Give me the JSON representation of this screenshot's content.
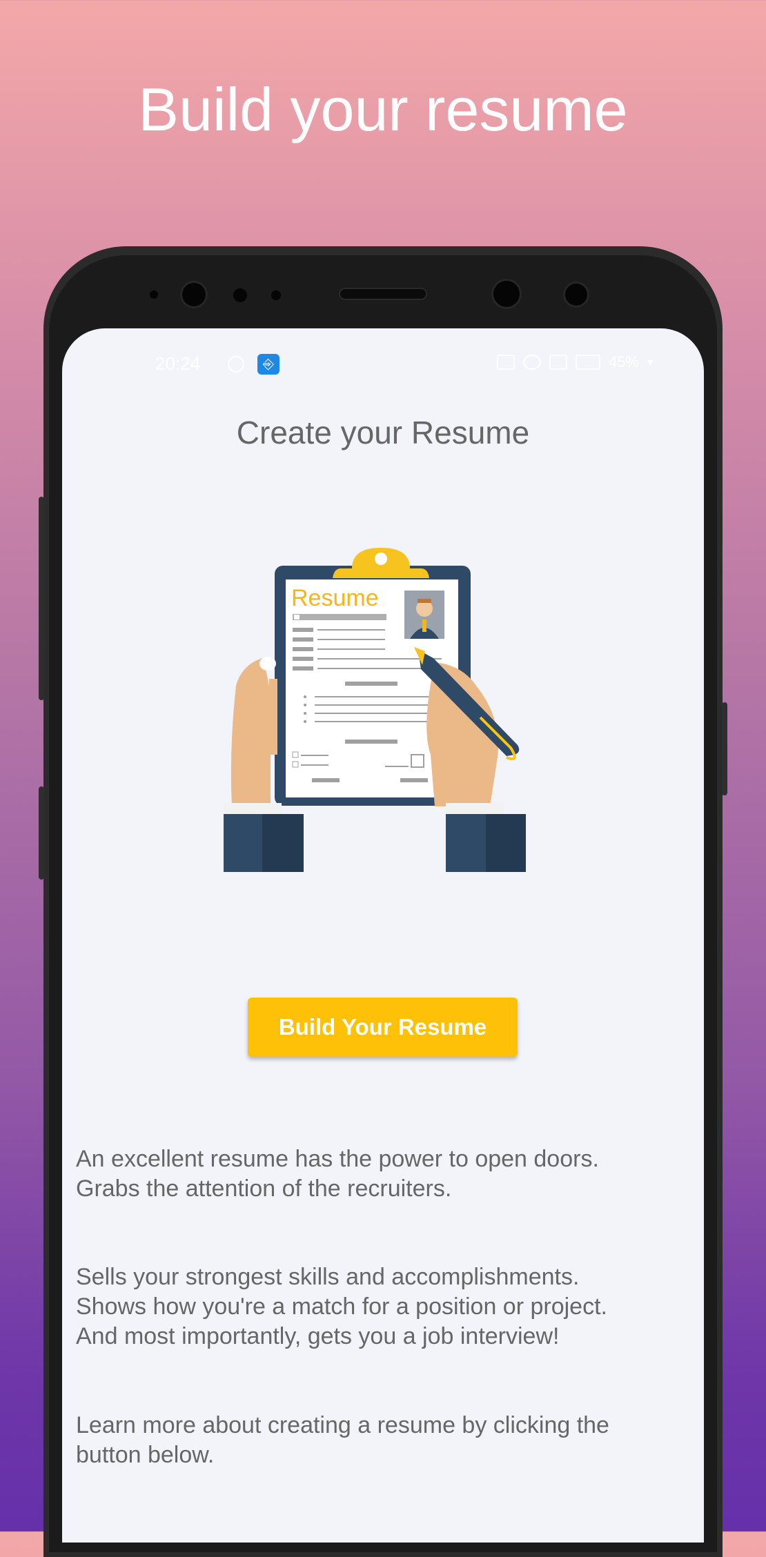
{
  "promo": {
    "title": "Build your resume"
  },
  "status_bar": {
    "time": "20:24",
    "battery": "45%",
    "icons": [
      "whatsapp-icon",
      "usb-icon",
      "cast-icon",
      "alarm-icon",
      "data-icon",
      "signal-icon",
      "battery-icon"
    ]
  },
  "screen": {
    "title": "Create your Resume",
    "illustration": {
      "clipboard_heading": "Resume"
    },
    "build_button_label": "Build Your Resume",
    "paragraphs": [
      "An excellent resume has the power to open doors.\nGrabs the attention of the recruiters.",
      " Sells your strongest skills and accomplishments.\nShows how you're a match for a position or project.\nAnd most importantly, gets you a job interview!",
      "Learn more about creating a resume by clicking the\nbutton below."
    ]
  },
  "colors": {
    "accent": "#ffc107",
    "text_gray": "#666666",
    "screen_bg": "#f3f4f9",
    "clipboard_navy": "#2f4a66"
  }
}
